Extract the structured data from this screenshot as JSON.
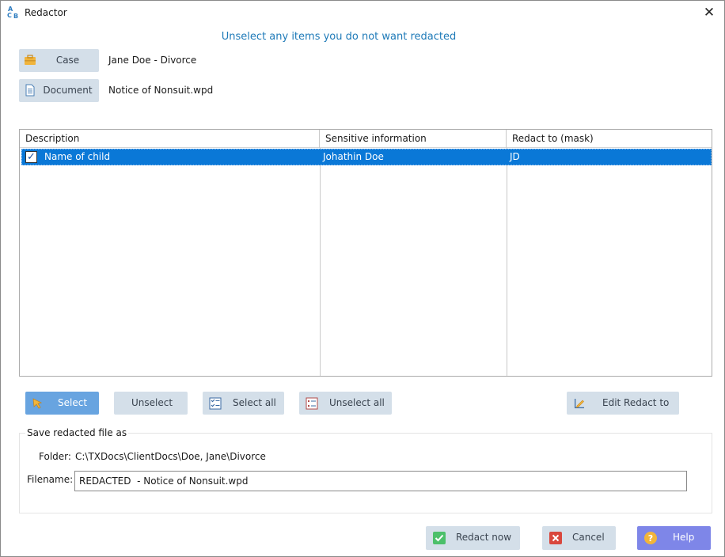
{
  "window": {
    "app_icon_letters": [
      "A",
      "C",
      "B"
    ],
    "title": "Redactor",
    "close_glyph": "✕"
  },
  "instruction": "Unselect any items you do not want redacted",
  "case": {
    "label": "Case",
    "value": "Jane Doe - Divorce",
    "icon": "briefcase-icon"
  },
  "document": {
    "label": "Document",
    "value": "Notice of Nonsuit.wpd",
    "icon": "document-icon"
  },
  "grid": {
    "columns": [
      "Description",
      "Sensitive information",
      "Redact to (mask)"
    ],
    "rows": [
      {
        "checked": true,
        "check_glyph": "✓",
        "description": "Name of child",
        "sensitive": "Johathin Doe",
        "mask": "JD"
      }
    ]
  },
  "actions": {
    "select": "Select",
    "unselect": "Unselect",
    "select_all": "Select all",
    "unselect_all": "Unselect all",
    "edit_redact_to": "Edit Redact to"
  },
  "save": {
    "title": "Save redacted file as",
    "folder_label": "Folder:",
    "folder_value": "C:\\TXDocs\\ClientDocs\\Doe, Jane\\Divorce",
    "filename_label": "Filename:",
    "filename_value": "REDACTED  - Notice of Nonsuit.wpd"
  },
  "footer": {
    "redact_now": "Redact now",
    "cancel": "Cancel",
    "help": "Help"
  },
  "colors": {
    "accent": "#1e7ab8",
    "selection": "#0a78d7",
    "button_bg": "#d4dfe9",
    "primary_button": "#68a4e0",
    "help_button": "#7e86e8"
  }
}
